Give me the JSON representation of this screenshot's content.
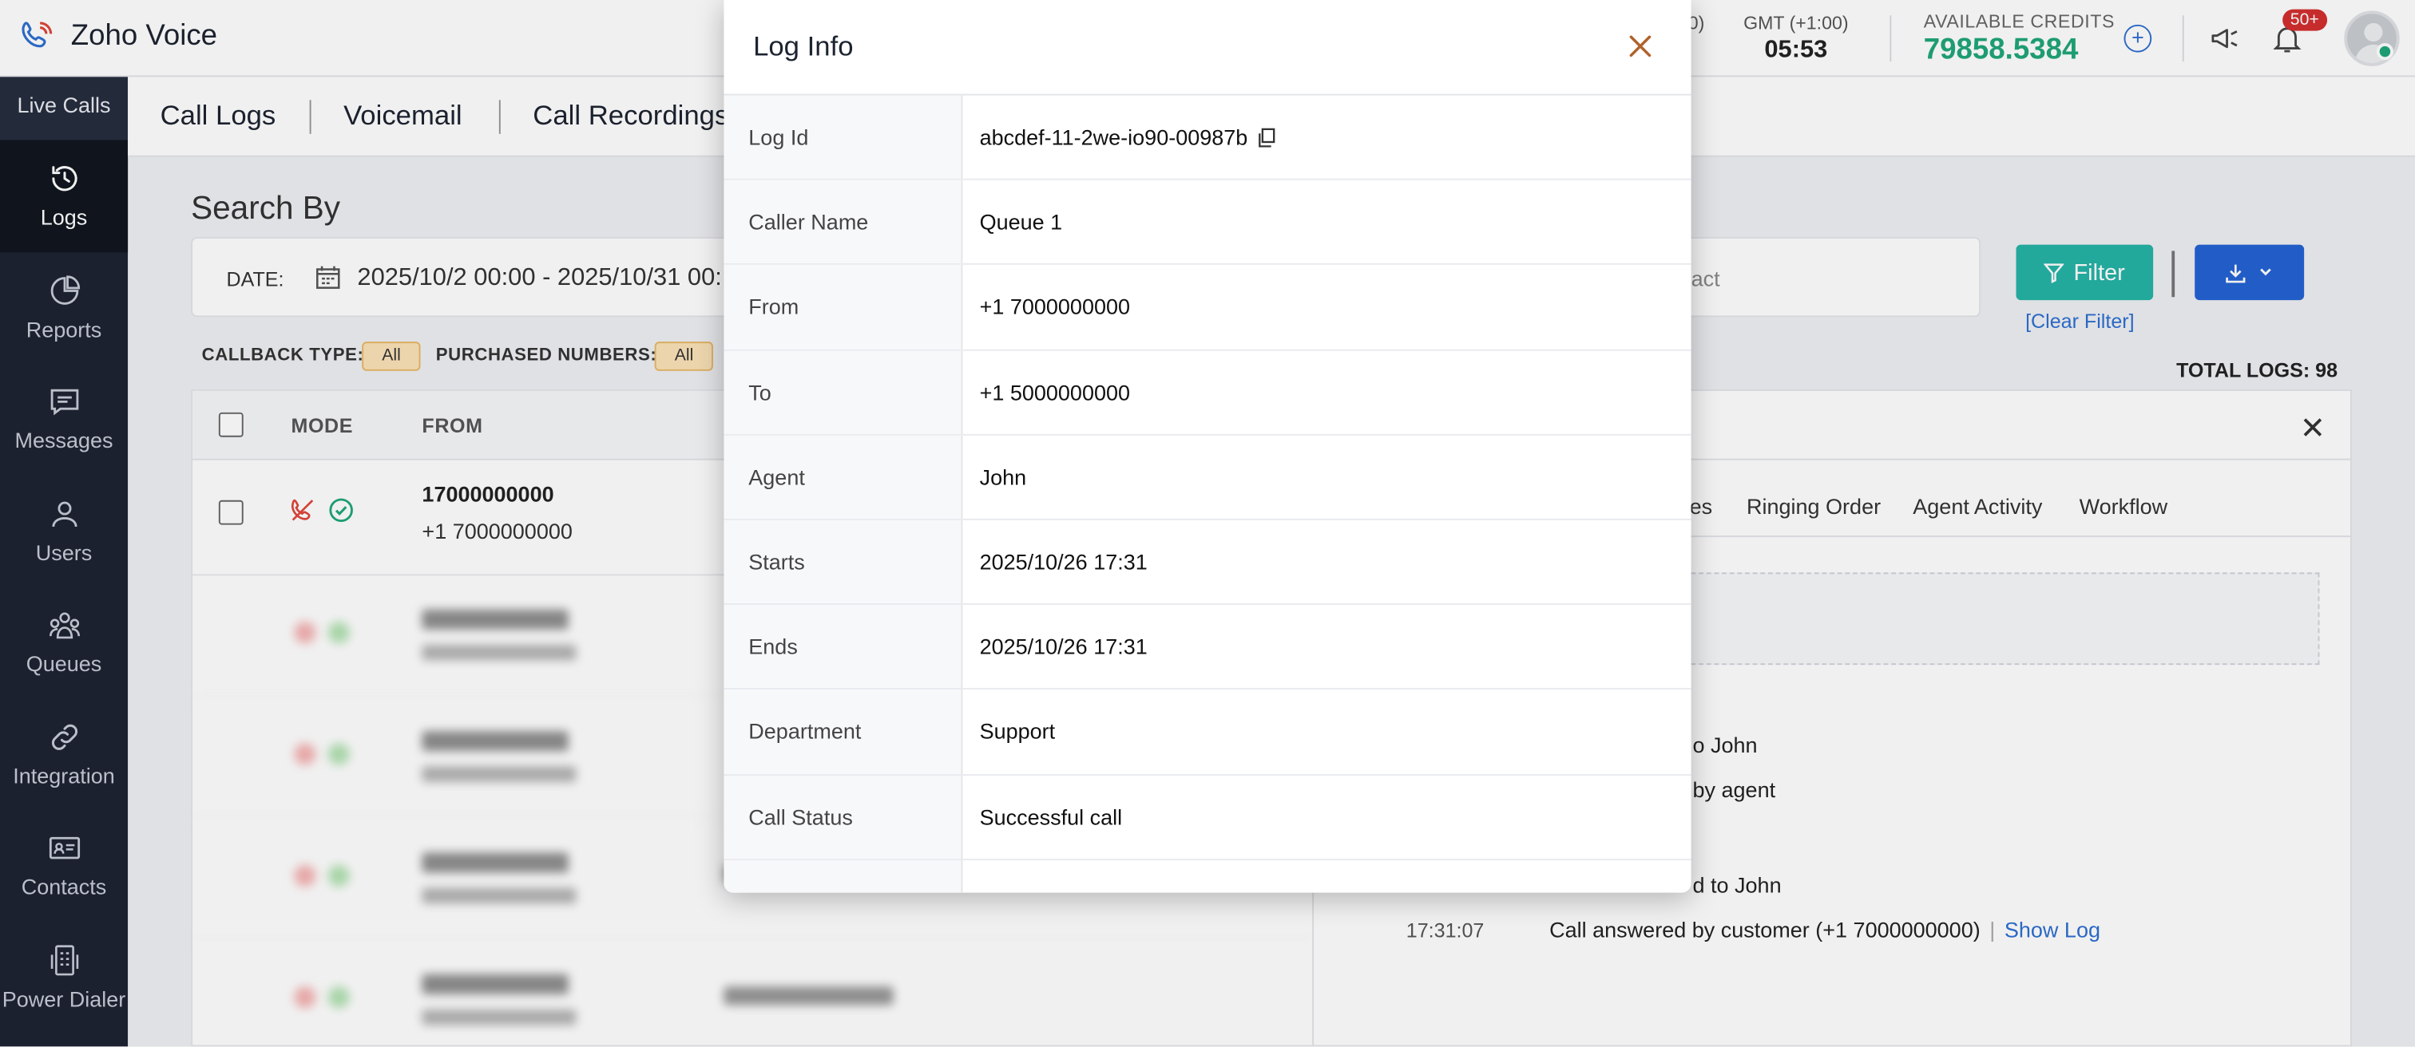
{
  "app": {
    "name": "Zoho Voice"
  },
  "header": {
    "tz_prev": "0)",
    "tz_label": "GMT (+1:00)",
    "tz_time": "05:53",
    "credits_label": "AVAILABLE CREDITS",
    "credits_value": "79858.5384",
    "notifications_badge": "50+"
  },
  "sidebar": {
    "live_calls": "Live Calls",
    "items": [
      {
        "label": "Logs",
        "icon": "history-icon",
        "active": true
      },
      {
        "label": "Reports",
        "icon": "pie-chart-icon"
      },
      {
        "label": "Messages",
        "icon": "message-icon"
      },
      {
        "label": "Users",
        "icon": "user-icon"
      },
      {
        "label": "Queues",
        "icon": "queues-icon"
      },
      {
        "label": "Integration",
        "icon": "link-icon"
      },
      {
        "label": "Contacts",
        "icon": "contact-card-icon"
      },
      {
        "label": "Power Dialer",
        "icon": "dialer-icon"
      }
    ]
  },
  "tabs": [
    "Call Logs",
    "Voicemail",
    "Call Recordings"
  ],
  "search": {
    "title": "Search By",
    "date_label": "DATE:",
    "date_value": "2025/10/2 00:00 - 2025/10/31 00:",
    "contact_placeholder": "act",
    "filter_label": "Filter",
    "clear_filter": "[Clear Filter]",
    "callback_type_label": "CALLBACK TYPE:",
    "callback_type_value": "All",
    "purchased_numbers_label": "PURCHASED NUMBERS:",
    "purchased_numbers_value": "All",
    "total_logs": "TOTAL LOGS: 98"
  },
  "table": {
    "headers": {
      "mode": "MODE",
      "from": "FROM"
    },
    "first_row": {
      "number": "17000000000",
      "sub": "+1 7000000000"
    }
  },
  "detail": {
    "tabs": [
      "es",
      "Ringing Order",
      "Agent Activity",
      "Workflow"
    ],
    "timeline": [
      {
        "time": "",
        "text": "o John"
      },
      {
        "time": "",
        "text": "by agent"
      },
      {
        "time": "",
        "text": "d to John"
      },
      {
        "time": "17:31:07",
        "text": "Call answered by customer (+1 7000000000)",
        "link": "Show Log"
      }
    ]
  },
  "modal": {
    "title": "Log Info",
    "rows": [
      {
        "key": "Log Id",
        "value": "abcdef-11-2we-io90-00987b",
        "copy": true
      },
      {
        "key": "Caller Name",
        "value": "Queue 1"
      },
      {
        "key": "From",
        "value": "+1 7000000000"
      },
      {
        "key": "To",
        "value": "+1 5000000000"
      },
      {
        "key": "Agent",
        "value": "John"
      },
      {
        "key": "Starts",
        "value": "2025/10/26 17:31"
      },
      {
        "key": "Ends",
        "value": "2025/10/26 17:31"
      },
      {
        "key": "Department",
        "value": "Support"
      },
      {
        "key": "Call Status",
        "value": "Successful call"
      }
    ]
  },
  "colors": {
    "accent_green": "#1fa67a",
    "filter_teal": "#26b3a6",
    "primary_blue": "#2563d4",
    "close_orange": "#b0622b"
  }
}
